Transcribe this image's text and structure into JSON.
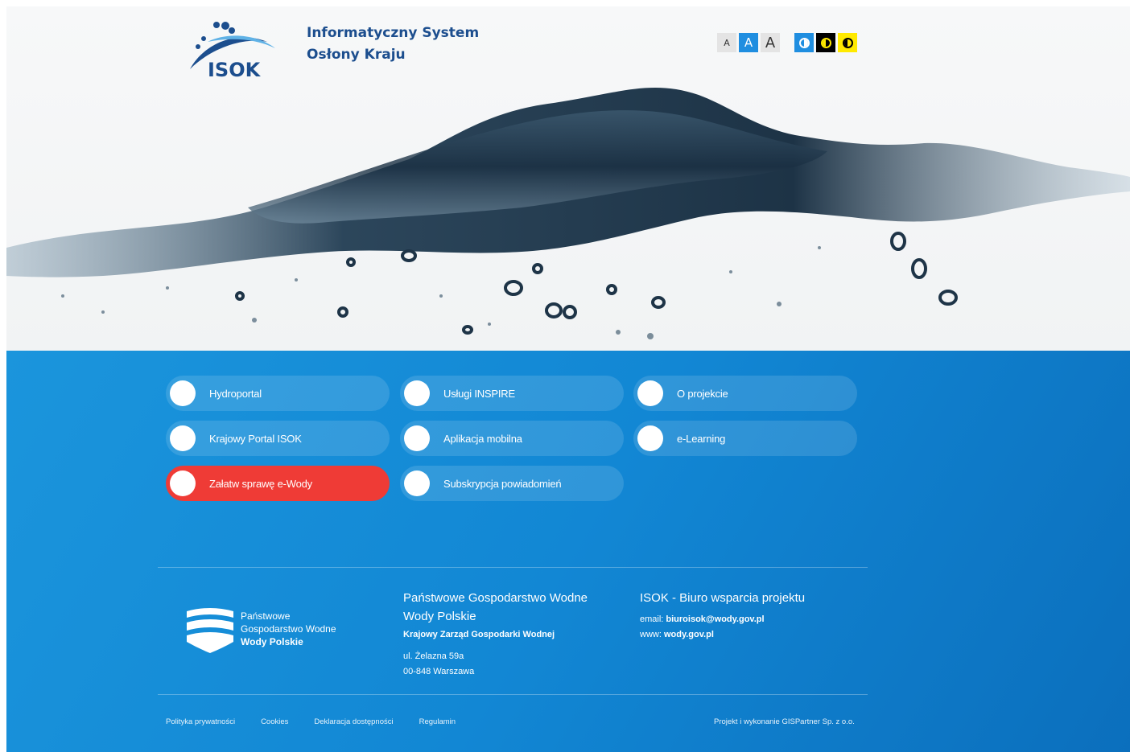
{
  "header": {
    "logo_text": "ISOK",
    "title_line1": "Informatyczny System",
    "title_line2": "Osłony Kraju",
    "font_size_buttons": [
      "A",
      "A",
      "A"
    ],
    "contrast_icons": [
      "contrast-default-icon",
      "contrast-black-icon",
      "contrast-yellow-icon"
    ]
  },
  "menu": {
    "tiles": [
      {
        "label": "Hydroportal"
      },
      {
        "label": "Usługi INSPIRE"
      },
      {
        "label": "O projekcie"
      },
      {
        "label": "Krajowy Portal ISOK"
      },
      {
        "label": "Aplikacja mobilna"
      },
      {
        "label": "e-Learning"
      },
      {
        "label": "Załatw sprawę e-Wody"
      },
      {
        "label": "Subskrypcja powiadomień"
      }
    ]
  },
  "footer": {
    "pgw_logo": {
      "line1": "Państwowe",
      "line2": "Gospodarstwo Wodne",
      "line3": "Wody Polskie"
    },
    "org": {
      "heading": "Państwowe Gospodarstwo Wodne Wody Polskie",
      "sub": "Krajowy Zarząd Gospodarki Wodnej",
      "addr1": "ul. Żelazna 59a",
      "addr2": "00-848 Warszawa"
    },
    "support": {
      "heading": "ISOK - Biuro wsparcia projektu",
      "email_label": "email:",
      "email": "biuroisok@wody.gov.pl",
      "www_label": "www:",
      "www": "wody.gov.pl"
    },
    "links": [
      "Polityka prywatności",
      "Cookies",
      "Deklaracja dostępności",
      "Regulamin"
    ],
    "credit": "Projekt i wykonanie GISPartner Sp. z o.o."
  },
  "colors": {
    "brand_blue": "#1c4e8e",
    "section_blue": "#1287d4",
    "accent_red": "#ef3b36",
    "active_button": "#1f8ee0",
    "contrast_yellow": "#ffea00"
  }
}
